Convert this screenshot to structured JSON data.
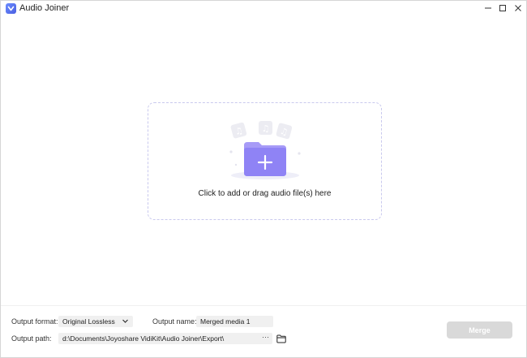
{
  "window": {
    "title": "Audio Joiner",
    "controls": {
      "minimize": "—",
      "maximize": "☐",
      "close": "✕"
    }
  },
  "dropzone": {
    "text": "Click to add or drag audio file(s) here",
    "icon": "add-folder-icon"
  },
  "settings": {
    "output_format_label": "Output format:",
    "output_format_value": "Original Lossless",
    "output_name_label": "Output name:",
    "output_name_value": "Merged media 1",
    "output_path_label": "Output path:",
    "output_path_value": "d:\\Documents\\Joyoshare VidiKit\\Audio Joiner\\Export\\",
    "browse_dots": "···"
  },
  "merge_button": {
    "label": "Merge"
  },
  "colors": {
    "accent": "#5b6ef0",
    "folder": "#8f83f5",
    "merge_disabled": "#d9d9d9",
    "field_bg": "#f0f0f0"
  }
}
